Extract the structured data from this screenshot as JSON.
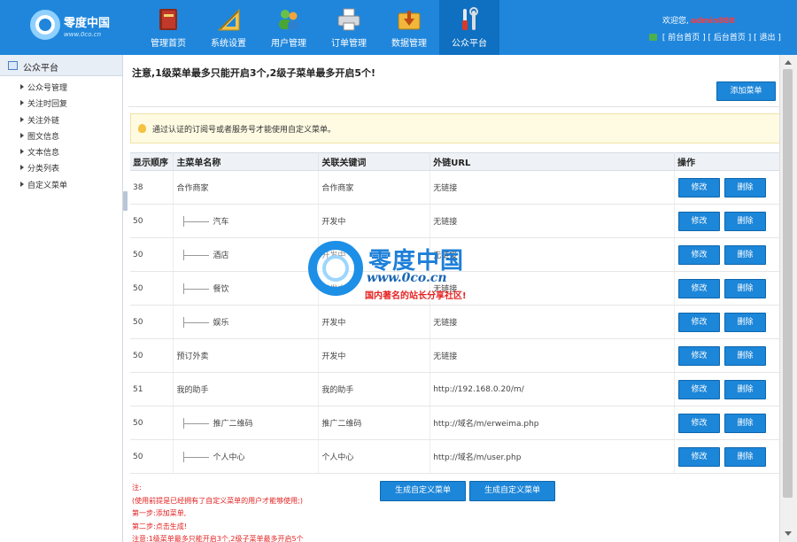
{
  "header": {
    "logo_title": "零度中国",
    "logo_url": "www.0co.cn",
    "welcome_prefix": "欢迎您,",
    "username": "admin888",
    "links": [
      {
        "label": "[ 前台首页 ]"
      },
      {
        "label": "[ 后台首页 ]"
      },
      {
        "label": "[ 退出 ]"
      }
    ]
  },
  "nav": [
    {
      "label": "管理首页",
      "icon": "book-icon",
      "active": false
    },
    {
      "label": "系统设置",
      "icon": "ruler-icon",
      "active": false
    },
    {
      "label": "用户管理",
      "icon": "users-icon",
      "active": false
    },
    {
      "label": "订单管理",
      "icon": "printer-icon",
      "active": false
    },
    {
      "label": "数据管理",
      "icon": "download-icon",
      "active": false
    },
    {
      "label": "公众平台",
      "icon": "tools-icon",
      "active": true
    }
  ],
  "sidebar": {
    "title": "公众平台",
    "items": [
      {
        "label": "公众号管理"
      },
      {
        "label": "关注时回复"
      },
      {
        "label": "关注外链"
      },
      {
        "label": "图文信息"
      },
      {
        "label": "文本信息"
      },
      {
        "label": "分类列表"
      },
      {
        "label": "自定义菜单"
      }
    ]
  },
  "main": {
    "notice": "注意,1级菜单最多只能开启3个,2级子菜单最多开启5个!",
    "add_button": "添加菜单",
    "tip": "通过认证的订阅号或者服务号才能使用自定义菜单。",
    "columns": [
      "显示顺序",
      "主菜单名称",
      "关联关键词",
      "外链URL",
      "操作"
    ],
    "rows": [
      {
        "order": "38",
        "name": "合作商家",
        "sub": false,
        "keyword": "合作商家",
        "url": "无链接"
      },
      {
        "order": "50",
        "name": "汽车",
        "sub": true,
        "keyword": "开发中",
        "url": "无链接"
      },
      {
        "order": "50",
        "name": "酒店",
        "sub": true,
        "keyword": "开发中",
        "url": "无链接"
      },
      {
        "order": "50",
        "name": "餐饮",
        "sub": true,
        "keyword": "开发中",
        "url": "无链接"
      },
      {
        "order": "50",
        "name": "娱乐",
        "sub": true,
        "keyword": "开发中",
        "url": "无链接"
      },
      {
        "order": "50",
        "name": "预订外卖",
        "sub": false,
        "keyword": "开发中",
        "url": "无链接"
      },
      {
        "order": "51",
        "name": "我的助手",
        "sub": false,
        "keyword": "我的助手",
        "url": "http://192.168.0.20/m/"
      },
      {
        "order": "50",
        "name": "推广二维码",
        "sub": true,
        "keyword": "推广二维码",
        "url": "http://域名/m/erweima.php"
      },
      {
        "order": "50",
        "name": "个人中心",
        "sub": true,
        "keyword": "个人中心",
        "url": "http://域名/m/user.php"
      }
    ],
    "edit_label": "修改",
    "delete_label": "删除",
    "footnote": [
      "注:",
      "(使用前提是已经拥有了自定义菜单的用户才能够使用;)",
      "第一步:添加菜单,",
      "第二步:点击生成!",
      "注意:1级菜单最多只能开启3个,2级子菜单最多开启5个"
    ],
    "generate_buttons": [
      "生成自定义菜单",
      "生成自定义菜单"
    ]
  },
  "watermark": {
    "title": "零度中国",
    "url": "www.0co.cn",
    "slogan": "国内著名的站长分享社区!"
  },
  "colors": {
    "header_bg": "#1f86dc",
    "nav_active_bg": "#0f6fc0",
    "button_blue": "#1c86d9",
    "footnote_red": "#e32121",
    "tip_bg": "#fffbe3"
  }
}
